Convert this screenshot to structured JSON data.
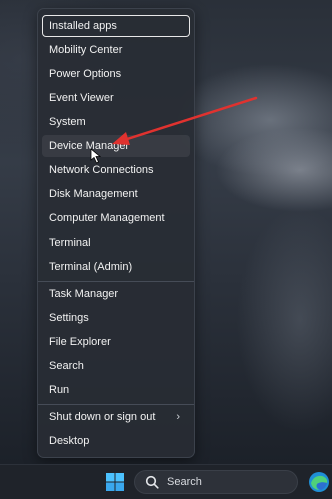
{
  "menu": {
    "items": [
      {
        "label": "Installed apps"
      },
      {
        "label": "Mobility Center"
      },
      {
        "label": "Power Options"
      },
      {
        "label": "Event Viewer"
      },
      {
        "label": "System"
      },
      {
        "label": "Device Manager"
      },
      {
        "label": "Network Connections"
      },
      {
        "label": "Disk Management"
      },
      {
        "label": "Computer Management"
      },
      {
        "label": "Terminal"
      },
      {
        "label": "Terminal (Admin)"
      },
      {
        "label": "Task Manager"
      },
      {
        "label": "Settings"
      },
      {
        "label": "File Explorer"
      },
      {
        "label": "Search"
      },
      {
        "label": "Run"
      },
      {
        "label": "Shut down or sign out"
      },
      {
        "label": "Desktop"
      }
    ]
  },
  "taskbar": {
    "search_label": "Search"
  },
  "colors": {
    "menu_bg": "#282c34",
    "annotation_arrow": "#e0322f"
  },
  "icons": [
    "windows-start-icon",
    "search-icon",
    "edge-browser-icon",
    "chevron-right-icon",
    "mouse-cursor-icon"
  ]
}
